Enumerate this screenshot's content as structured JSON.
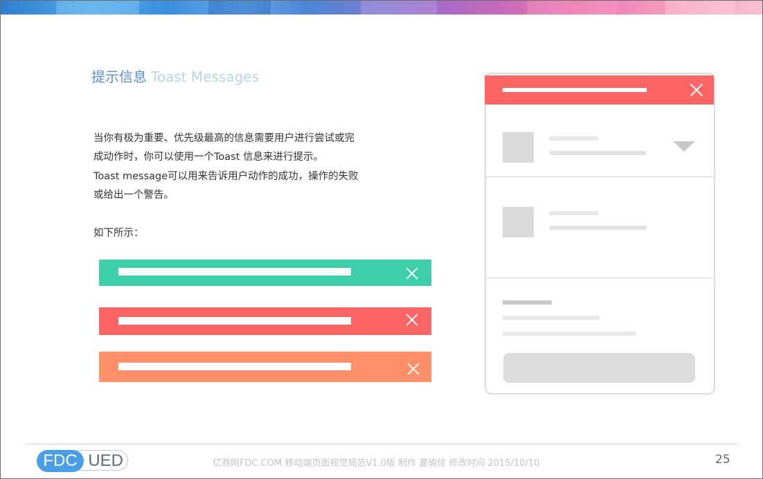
{
  "colors": {
    "title_cn": "#5b8fd6",
    "title_en": "#b9d2f2",
    "toast_success": "#3ccfaa",
    "toast_error": "#fd6464",
    "toast_warning": "#ff8f68",
    "phone_header": "#fd6464"
  },
  "slide": {
    "title_cn": "提示信息",
    "title_en": "Toast Messages",
    "paragraph_lines": [
      "当你有极为重要、优先级最高的信息需要用户进行尝试或完",
      "成动作时，你可以使用一个Toast 信息来进行提示。",
      "Toast message可以用来告诉用户动作的成功，操作的失败",
      "或给出一个警告。"
    ],
    "example_intro": "如下所示："
  },
  "toasts": [
    {
      "type": "success",
      "icon": "close-icon"
    },
    {
      "type": "error",
      "icon": "close-icon"
    },
    {
      "type": "warning",
      "icon": "close-icon"
    }
  ],
  "mockup": {
    "header_icon": "close-icon",
    "dropdown_icon": "triangle-down-icon"
  },
  "footer": {
    "logo_left": "FDC",
    "logo_right": "UED",
    "info": "亿商网FDC.COM 移动端页面视觉规范V1.0版   制作 夏瑜佳     修改时间   2015/10/10",
    "page_number": "25"
  }
}
